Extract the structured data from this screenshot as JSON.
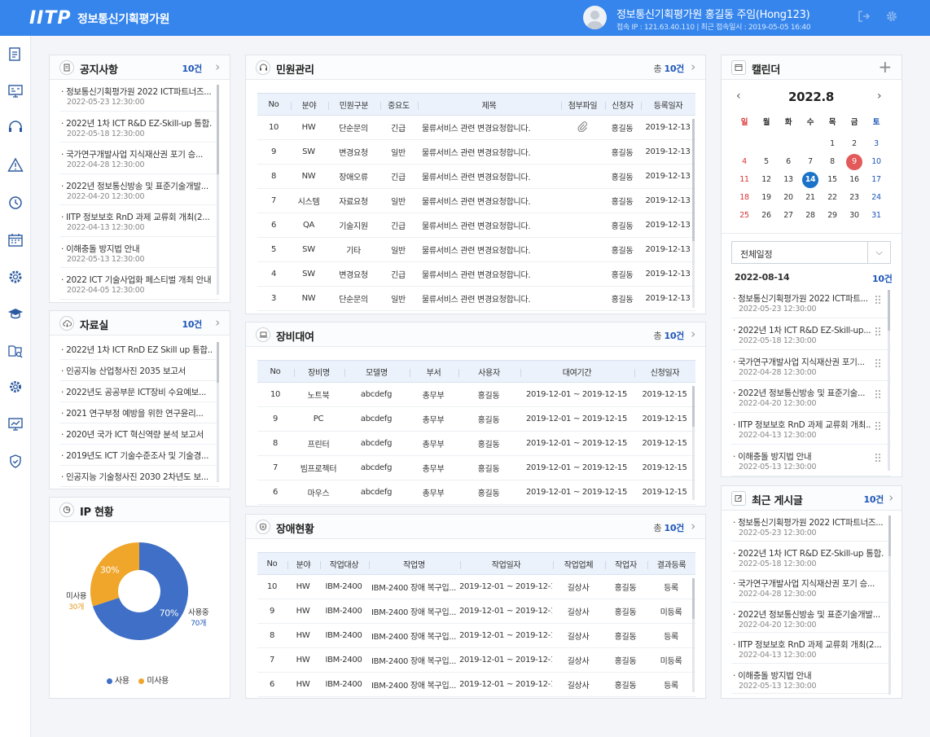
{
  "header": {
    "logo": "IITP",
    "org_name": "정보통신기획평가원",
    "user_name": "정보통신기획평가원 홍길동 주임(Hong123)",
    "user_meta": "접속 IP : 121.63.40.110  |  최근 접속일시 : 2019-05-05  16:40"
  },
  "notice": {
    "title": "공지사항",
    "count": "10건",
    "items": [
      {
        "title": "· 정보통신기획평가원 2022 ICT파트너즈...",
        "date": "2022-05-23  12:30:00"
      },
      {
        "title": "· 2022년 1차 ICT R&D EZ-Skill-up 통합...",
        "date": "2022-05-18  12:30:00"
      },
      {
        "title": "· 국가연구개발사업 지식재산권 포기 승...",
        "date": "2022-04-28  12:30:00"
      },
      {
        "title": "· 2022년 정보통신방송 및 표준기술개발...",
        "date": "2022-04-20  12:30:00"
      },
      {
        "title": "· IITP 정보보호 RnD 과제 교류회 개최(2...",
        "date": "2022-04-13  12:30:00"
      },
      {
        "title": "· 이해충돌 방지법 안내",
        "date": "2022-05-13  12:30:00"
      },
      {
        "title": "· 2022 ICT 기술사업화 페스티벌 개최 안내",
        "date": "2022-04-05  12:30:00"
      }
    ]
  },
  "archive": {
    "title": "자료실",
    "count": "10건",
    "items": [
      "· 2022년 1차 ICT RnD EZ Skill up 통합...",
      "· 인공지능 산업청사진 2035 보고서",
      "· 2022년도 공공부문 ICT장비 수요예보...",
      "· 2021 연구부정 예방을 위한 연구윤리...",
      "· 2020년 국가 ICT 혁신역량 분석 보고서",
      "· 2019년도 ICT 기술수준조사 및 기술경...",
      "· 인공지능 기술청사진 2030 2차년도 보..."
    ]
  },
  "ip": {
    "title": "IP 현황",
    "unused_label": "미사용",
    "unused_count": "30개",
    "used_label": "사용중",
    "used_count": "70개",
    "legend_used": "사용",
    "legend_unused": "미사용",
    "colors": {
      "used": "#3f6fc6",
      "unused": "#f0a62b"
    }
  },
  "chart_data": {
    "type": "pie",
    "categories": [
      "사용중",
      "미사용"
    ],
    "values": [
      70,
      30
    ],
    "labels": [
      "70%",
      "30%"
    ],
    "colors": [
      "#3f6fc6",
      "#f0a62b"
    ]
  },
  "civil": {
    "title": "민원관리",
    "count_prefix": "총 ",
    "count": "10건",
    "columns": [
      "No",
      "분야",
      "민원구분",
      "중요도",
      "제목",
      "첨부파일",
      "신청자",
      "등록일자"
    ],
    "rows": [
      [
        "10",
        "HW",
        "단순문의",
        "긴급",
        "물류서비스 관련 변경요청합니다.",
        "clip",
        "홍길동",
        "2019-12-13"
      ],
      [
        "9",
        "SW",
        "변경요청",
        "일반",
        "물류서비스 관련 변경요청합니다.",
        "",
        "홍길동",
        "2019-12-13"
      ],
      [
        "8",
        "NW",
        "장애오류",
        "긴급",
        "물류서비스 관련 변경요청합니다.",
        "",
        "홍길동",
        "2019-12-13"
      ],
      [
        "7",
        "시스템",
        "자료요청",
        "일반",
        "물류서비스 관련 변경요청합니다.",
        "",
        "홍길동",
        "2019-12-13"
      ],
      [
        "6",
        "QA",
        "기술지원",
        "긴급",
        "물류서비스 관련 변경요청합니다.",
        "",
        "홍길동",
        "2019-12-13"
      ],
      [
        "5",
        "SW",
        "기타",
        "일반",
        "물류서비스 관련 변경요청합니다.",
        "",
        "홍길동",
        "2019-12-13"
      ],
      [
        "4",
        "SW",
        "변경요청",
        "긴급",
        "물류서비스 관련 변경요청합니다.",
        "",
        "홍길동",
        "2019-12-13"
      ],
      [
        "3",
        "NW",
        "단순문의",
        "일반",
        "물류서비스 관련 변경요청합니다.",
        "",
        "홍길동",
        "2019-12-13"
      ]
    ]
  },
  "equip": {
    "title": "장비대여",
    "count_prefix": "총 ",
    "count": "10건",
    "columns": [
      "No",
      "장비명",
      "모델명",
      "부서",
      "사용자",
      "대여기간",
      "신청일자"
    ],
    "rows": [
      [
        "10",
        "노트북",
        "abcdefg",
        "총무부",
        "홍길동",
        "2019-12-01 ~ 2019-12-15",
        "2019-12-15"
      ],
      [
        "9",
        "PC",
        "abcdefg",
        "총무부",
        "홍길동",
        "2019-12-01 ~ 2019-12-15",
        "2019-12-15"
      ],
      [
        "8",
        "프린터",
        "abcdefg",
        "총무부",
        "홍길동",
        "2019-12-01 ~ 2019-12-15",
        "2019-12-15"
      ],
      [
        "7",
        "빔프로젝터",
        "abcdefg",
        "총무부",
        "홍길동",
        "2019-12-01 ~ 2019-12-15",
        "2019-12-15"
      ],
      [
        "6",
        "마우스",
        "abcdefg",
        "총무부",
        "홍길동",
        "2019-12-01 ~ 2019-12-15",
        "2019-12-15"
      ]
    ]
  },
  "fault": {
    "title": "장애현황",
    "count_prefix": "총 ",
    "count": "10건",
    "columns": [
      "No",
      "분야",
      "작업대상",
      "작업명",
      "작업일자",
      "작업업체",
      "작업자",
      "결과등록"
    ],
    "rows": [
      [
        "10",
        "HW",
        "IBM-2400",
        "IBM-2400 장애 복구입...",
        "2019-12-01 ~ 2019-12-15",
        "길상사",
        "홍길동",
        "등록"
      ],
      [
        "9",
        "HW",
        "IBM-2400",
        "IBM-2400 장애 복구입...",
        "2019-12-01 ~ 2019-12-15",
        "길상사",
        "홍길동",
        "미등록"
      ],
      [
        "8",
        "HW",
        "IBM-2400",
        "IBM-2400 장애 복구입...",
        "2019-12-01 ~ 2019-12-15",
        "길상사",
        "홍길동",
        "등록"
      ],
      [
        "7",
        "HW",
        "IBM-2400",
        "IBM-2400 장애 복구입...",
        "2019-12-01 ~ 2019-12-15",
        "길상사",
        "홍길동",
        "미등록"
      ],
      [
        "6",
        "HW",
        "IBM-2400",
        "IBM-2400 장애 복구입...",
        "2019-12-01 ~ 2019-12-15",
        "길상사",
        "홍길동",
        "등록"
      ]
    ]
  },
  "calendar": {
    "title": "캘린더",
    "month": "2022.8",
    "weekdays": [
      "일",
      "월",
      "화",
      "수",
      "목",
      "금",
      "토"
    ],
    "weeks": [
      [
        "",
        "",
        "",
        "",
        "1",
        "2",
        "3"
      ],
      [
        "4",
        "5",
        "6",
        "7",
        "8",
        "9",
        "10"
      ],
      [
        "11",
        "12",
        "13",
        "14",
        "15",
        "16",
        "17"
      ],
      [
        "18",
        "19",
        "20",
        "21",
        "22",
        "23",
        "24"
      ],
      [
        "25",
        "26",
        "27",
        "28",
        "29",
        "30",
        "31"
      ]
    ],
    "highlight_day": "9",
    "today": "14",
    "filter_value": "전체일정",
    "selected_date": "2022-08-14",
    "selected_count": "10건",
    "events": [
      {
        "title": "· 정보통신기획평가원 2022 ICT파트...",
        "date": "2022-05-23  12:30:00"
      },
      {
        "title": "· 2022년 1차 ICT R&D EZ-Skill-up...",
        "date": "2022-05-18  12:30:00"
      },
      {
        "title": "· 국가연구개발사업 지식재산권 포기...",
        "date": "2022-04-28  12:30:00"
      },
      {
        "title": "· 2022년 정보통신방송 및 표준기술...",
        "date": "2022-04-20  12:30:00"
      },
      {
        "title": "· IITP 정보보호 RnD 과제 교류회 개최...",
        "date": "2022-04-13  12:30:00"
      },
      {
        "title": "· 이해충돌 방지법 안내",
        "date": "2022-05-13  12:30:00"
      }
    ]
  },
  "recent": {
    "title": "최근 게시글",
    "count": "10건",
    "items": [
      {
        "title": "· 정보통신기획평가원 2022 ICT파트너즈...",
        "date": "2022-05-23  12:30:00"
      },
      {
        "title": "· 2022년 1차 ICT R&D EZ-Skill-up 통합...",
        "date": "2022-05-18  12:30:00"
      },
      {
        "title": "· 국가연구개발사업 지식재산권 포기 승...",
        "date": "2022-04-28  12:30:00"
      },
      {
        "title": "· 2022년 정보통신방송 및 표준기술개발...",
        "date": "2022-04-20  12:30:00"
      },
      {
        "title": "· IITP 정보보호 RnD 과제 교류회 개최(2...",
        "date": "2022-04-13  12:30:00"
      },
      {
        "title": "· 이해충돌 방지법 안내",
        "date": "2022-05-13  12:30:00"
      }
    ]
  },
  "sidenav_icons": [
    "document-icon",
    "presentation-icon",
    "headset-icon",
    "warning-icon",
    "clock-icon",
    "calendar-icon",
    "settings-cluster-icon",
    "graduation-icon",
    "book-search-icon",
    "gear-icon",
    "chart-board-icon",
    "shield-icon"
  ]
}
